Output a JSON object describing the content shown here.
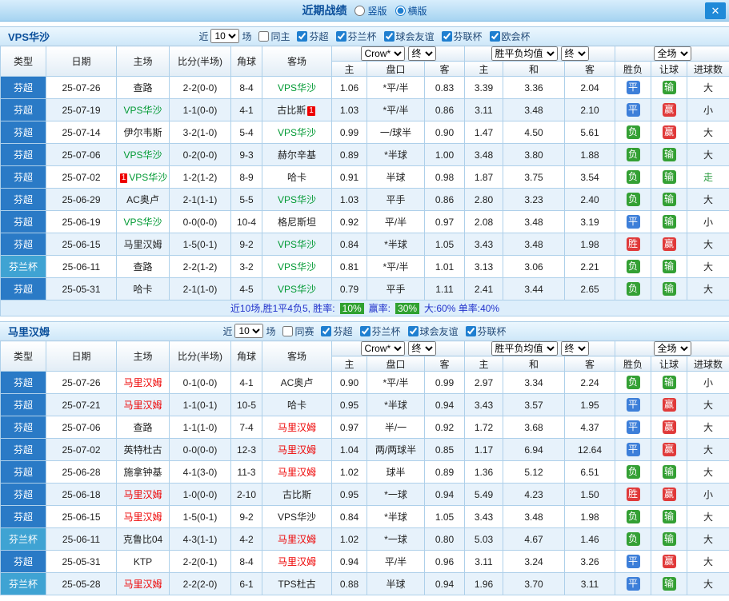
{
  "topbar": {
    "title": "近期战绩",
    "radios": [
      {
        "label": "竖版",
        "selected": false
      },
      {
        "label": "横版",
        "selected": true
      }
    ],
    "close_label": "✕"
  },
  "table_head": {
    "static_cols": [
      "类型",
      "日期",
      "主场",
      "比分(半场)",
      "角球",
      "客场"
    ],
    "odds_group": {
      "selects": [
        "Crow*",
        "终"
      ],
      "cols": [
        "主",
        "盘口",
        "客"
      ]
    },
    "europe_group": {
      "selects": [
        "胜平负均值",
        "终"
      ],
      "cols": [
        "主",
        "和",
        "客"
      ]
    },
    "result_group": {
      "selects": [
        "全场"
      ],
      "cols": [
        "胜负",
        "让球",
        "进球数"
      ]
    }
  },
  "sections": [
    {
      "team": "VPS华沙",
      "focus_color": "#009933",
      "filters": {
        "near": "近",
        "count": "10",
        "unit": "场",
        "checkboxes": [
          {
            "label": "同主",
            "checked": false
          },
          {
            "label": "芬超",
            "checked": true
          },
          {
            "label": "芬兰杯",
            "checked": true
          },
          {
            "label": "球会友谊",
            "checked": true
          },
          {
            "label": "芬联杯",
            "checked": true
          },
          {
            "label": "欧会杯",
            "checked": true
          }
        ]
      },
      "rows": [
        {
          "type": "芬超",
          "cup": false,
          "date": "25-07-26",
          "home": "查路",
          "home_focus": false,
          "home_card": null,
          "score": "2-2(0-0)",
          "corner": "8-4",
          "away": "VPS华沙",
          "away_focus": true,
          "away_card": null,
          "odds": [
            "1.06",
            "*平/半",
            "0.83"
          ],
          "euro": [
            "3.39",
            "3.36",
            "2.04"
          ],
          "wdl": "平",
          "handicap": "输",
          "goals": "大"
        },
        {
          "type": "芬超",
          "cup": false,
          "date": "25-07-19",
          "home": "VPS华沙",
          "home_focus": true,
          "home_card": null,
          "score": "1-1(0-0)",
          "corner": "4-1",
          "away": "古比斯",
          "away_focus": false,
          "away_card": "1",
          "odds": [
            "1.03",
            "*平/半",
            "0.86"
          ],
          "euro": [
            "3.11",
            "3.48",
            "2.10"
          ],
          "wdl": "平",
          "handicap": "赢",
          "goals": "小"
        },
        {
          "type": "芬超",
          "cup": false,
          "date": "25-07-14",
          "home": "伊尔韦斯",
          "home_focus": false,
          "home_card": null,
          "score": "3-2(1-0)",
          "corner": "5-4",
          "away": "VPS华沙",
          "away_focus": true,
          "away_card": null,
          "odds": [
            "0.99",
            "一/球半",
            "0.90"
          ],
          "euro": [
            "1.47",
            "4.50",
            "5.61"
          ],
          "wdl": "负",
          "handicap": "赢",
          "goals": "大"
        },
        {
          "type": "芬超",
          "cup": false,
          "date": "25-07-06",
          "home": "VPS华沙",
          "home_focus": true,
          "home_card": null,
          "score": "0-2(0-0)",
          "corner": "9-3",
          "away": "赫尔辛基",
          "away_focus": false,
          "away_card": null,
          "odds": [
            "0.89",
            "*半球",
            "1.00"
          ],
          "euro": [
            "3.48",
            "3.80",
            "1.88"
          ],
          "wdl": "负",
          "handicap": "输",
          "goals": "大"
        },
        {
          "type": "芬超",
          "cup": false,
          "date": "25-07-02",
          "home": "VPS华沙",
          "home_focus": true,
          "home_card": "1",
          "score": "1-2(1-2)",
          "corner": "8-9",
          "away": "哈卡",
          "away_focus": false,
          "away_card": null,
          "odds": [
            "0.91",
            "半球",
            "0.98"
          ],
          "euro": [
            "1.87",
            "3.75",
            "3.54"
          ],
          "wdl": "负",
          "handicap": "输",
          "goals": "走"
        },
        {
          "type": "芬超",
          "cup": false,
          "date": "25-06-29",
          "home": "AC奥卢",
          "home_focus": false,
          "home_card": null,
          "score": "2-1(1-1)",
          "corner": "5-5",
          "away": "VPS华沙",
          "away_focus": true,
          "away_card": null,
          "odds": [
            "1.03",
            "平手",
            "0.86"
          ],
          "euro": [
            "2.80",
            "3.23",
            "2.40"
          ],
          "wdl": "负",
          "handicap": "输",
          "goals": "大"
        },
        {
          "type": "芬超",
          "cup": false,
          "date": "25-06-19",
          "home": "VPS华沙",
          "home_focus": true,
          "home_card": null,
          "score": "0-0(0-0)",
          "corner": "10-4",
          "away": "格尼斯坦",
          "away_focus": false,
          "away_card": null,
          "odds": [
            "0.92",
            "平/半",
            "0.97"
          ],
          "euro": [
            "2.08",
            "3.48",
            "3.19"
          ],
          "wdl": "平",
          "handicap": "输",
          "goals": "小"
        },
        {
          "type": "芬超",
          "cup": false,
          "date": "25-06-15",
          "home": "马里汉姆",
          "home_focus": false,
          "home_card": null,
          "score": "1-5(0-1)",
          "corner": "9-2",
          "away": "VPS华沙",
          "away_focus": true,
          "away_card": null,
          "odds": [
            "0.84",
            "*半球",
            "1.05"
          ],
          "euro": [
            "3.43",
            "3.48",
            "1.98"
          ],
          "wdl": "胜",
          "handicap": "赢",
          "goals": "大"
        },
        {
          "type": "芬兰杯",
          "cup": true,
          "date": "25-06-11",
          "home": "查路",
          "home_focus": false,
          "home_card": null,
          "score": "2-2(1-2)",
          "corner": "3-2",
          "away": "VPS华沙",
          "away_focus": true,
          "away_card": null,
          "odds": [
            "0.81",
            "*平/半",
            "1.01"
          ],
          "euro": [
            "3.13",
            "3.06",
            "2.21"
          ],
          "wdl": "负",
          "handicap": "输",
          "goals": "大"
        },
        {
          "type": "芬超",
          "cup": false,
          "date": "25-05-31",
          "home": "哈卡",
          "home_focus": false,
          "home_card": null,
          "score": "2-1(1-0)",
          "corner": "4-5",
          "away": "VPS华沙",
          "away_focus": true,
          "away_card": null,
          "odds": [
            "0.79",
            "平手",
            "1.11"
          ],
          "euro": [
            "2.41",
            "3.44",
            "2.65"
          ],
          "wdl": "负",
          "handicap": "输",
          "goals": "大"
        }
      ],
      "summary": {
        "segments": [
          {
            "text": "近10场,胜1平4负5, 胜率:"
          },
          {
            "badge": "10%"
          },
          {
            "text": "赢率:"
          },
          {
            "badge": "30%"
          },
          {
            "text": "大:60% 单率:40%"
          }
        ]
      }
    },
    {
      "team": "马里汉姆",
      "focus_color": "#ee0000",
      "filters": {
        "near": "近",
        "count": "10",
        "unit": "场",
        "checkboxes": [
          {
            "label": "同赛",
            "checked": false
          },
          {
            "label": "芬超",
            "checked": true
          },
          {
            "label": "芬兰杯",
            "checked": true
          },
          {
            "label": "球会友谊",
            "checked": true
          },
          {
            "label": "芬联杯",
            "checked": true
          }
        ]
      },
      "rows": [
        {
          "type": "芬超",
          "cup": false,
          "date": "25-07-26",
          "home": "马里汉姆",
          "home_focus": true,
          "home_card": null,
          "score": "0-1(0-0)",
          "corner": "4-1",
          "away": "AC奥卢",
          "away_focus": false,
          "away_card": null,
          "odds": [
            "0.90",
            "*平/半",
            "0.99"
          ],
          "euro": [
            "2.97",
            "3.34",
            "2.24"
          ],
          "wdl": "负",
          "handicap": "输",
          "goals": "小"
        },
        {
          "type": "芬超",
          "cup": false,
          "date": "25-07-21",
          "home": "马里汉姆",
          "home_focus": true,
          "home_card": null,
          "score": "1-1(0-1)",
          "corner": "10-5",
          "away": "哈卡",
          "away_focus": false,
          "away_card": null,
          "odds": [
            "0.95",
            "*半球",
            "0.94"
          ],
          "euro": [
            "3.43",
            "3.57",
            "1.95"
          ],
          "wdl": "平",
          "handicap": "赢",
          "goals": "大"
        },
        {
          "type": "芬超",
          "cup": false,
          "date": "25-07-06",
          "home": "查路",
          "home_focus": false,
          "home_card": null,
          "score": "1-1(1-0)",
          "corner": "7-4",
          "away": "马里汉姆",
          "away_focus": true,
          "away_card": null,
          "odds": [
            "0.97",
            "半/一",
            "0.92"
          ],
          "euro": [
            "1.72",
            "3.68",
            "4.37"
          ],
          "wdl": "平",
          "handicap": "赢",
          "goals": "大"
        },
        {
          "type": "芬超",
          "cup": false,
          "date": "25-07-02",
          "home": "英特杜古",
          "home_focus": false,
          "home_card": null,
          "score": "0-0(0-0)",
          "corner": "12-3",
          "away": "马里汉姆",
          "away_focus": true,
          "away_card": null,
          "odds": [
            "1.04",
            "两/两球半",
            "0.85"
          ],
          "euro": [
            "1.17",
            "6.94",
            "12.64"
          ],
          "wdl": "平",
          "handicap": "赢",
          "goals": "大"
        },
        {
          "type": "芬超",
          "cup": false,
          "date": "25-06-28",
          "home": "施拿钟基",
          "home_focus": false,
          "home_card": null,
          "score": "4-1(3-0)",
          "corner": "11-3",
          "away": "马里汉姆",
          "away_focus": true,
          "away_card": null,
          "odds": [
            "1.02",
            "球半",
            "0.89"
          ],
          "euro": [
            "1.36",
            "5.12",
            "6.51"
          ],
          "wdl": "负",
          "handicap": "输",
          "goals": "大"
        },
        {
          "type": "芬超",
          "cup": false,
          "date": "25-06-18",
          "home": "马里汉姆",
          "home_focus": true,
          "home_card": null,
          "score": "1-0(0-0)",
          "corner": "2-10",
          "away": "古比斯",
          "away_focus": false,
          "away_card": null,
          "odds": [
            "0.95",
            "*一球",
            "0.94"
          ],
          "euro": [
            "5.49",
            "4.23",
            "1.50"
          ],
          "wdl": "胜",
          "handicap": "赢",
          "goals": "小"
        },
        {
          "type": "芬超",
          "cup": false,
          "date": "25-06-15",
          "home": "马里汉姆",
          "home_focus": true,
          "home_card": null,
          "score": "1-5(0-1)",
          "corner": "9-2",
          "away": "VPS华沙",
          "away_focus": false,
          "away_card": null,
          "odds": [
            "0.84",
            "*半球",
            "1.05"
          ],
          "euro": [
            "3.43",
            "3.48",
            "1.98"
          ],
          "wdl": "负",
          "handicap": "输",
          "goals": "大"
        },
        {
          "type": "芬兰杯",
          "cup": true,
          "date": "25-06-11",
          "home": "克鲁比04",
          "home_focus": false,
          "home_card": null,
          "score": "4-3(1-1)",
          "corner": "4-2",
          "away": "马里汉姆",
          "away_focus": true,
          "away_card": null,
          "odds": [
            "1.02",
            "*一球",
            "0.80"
          ],
          "euro": [
            "5.03",
            "4.67",
            "1.46"
          ],
          "wdl": "负",
          "handicap": "输",
          "goals": "大"
        },
        {
          "type": "芬超",
          "cup": false,
          "date": "25-05-31",
          "home": "KTP",
          "home_focus": false,
          "home_card": null,
          "score": "2-2(0-1)",
          "corner": "8-4",
          "away": "马里汉姆",
          "away_focus": true,
          "away_card": null,
          "odds": [
            "0.94",
            "平/半",
            "0.96"
          ],
          "euro": [
            "3.11",
            "3.24",
            "3.26"
          ],
          "wdl": "平",
          "handicap": "赢",
          "goals": "大"
        },
        {
          "type": "芬兰杯",
          "cup": true,
          "date": "25-05-28",
          "home": "马里汉姆",
          "home_focus": true,
          "home_card": null,
          "score": "2-2(2-0)",
          "corner": "6-1",
          "away": "TPS杜古",
          "away_focus": false,
          "away_card": null,
          "odds": [
            "0.88",
            "半球",
            "0.94"
          ],
          "euro": [
            "1.96",
            "3.70",
            "3.11"
          ],
          "wdl": "平",
          "handicap": "输",
          "goals": "大"
        }
      ],
      "summary": null
    }
  ]
}
